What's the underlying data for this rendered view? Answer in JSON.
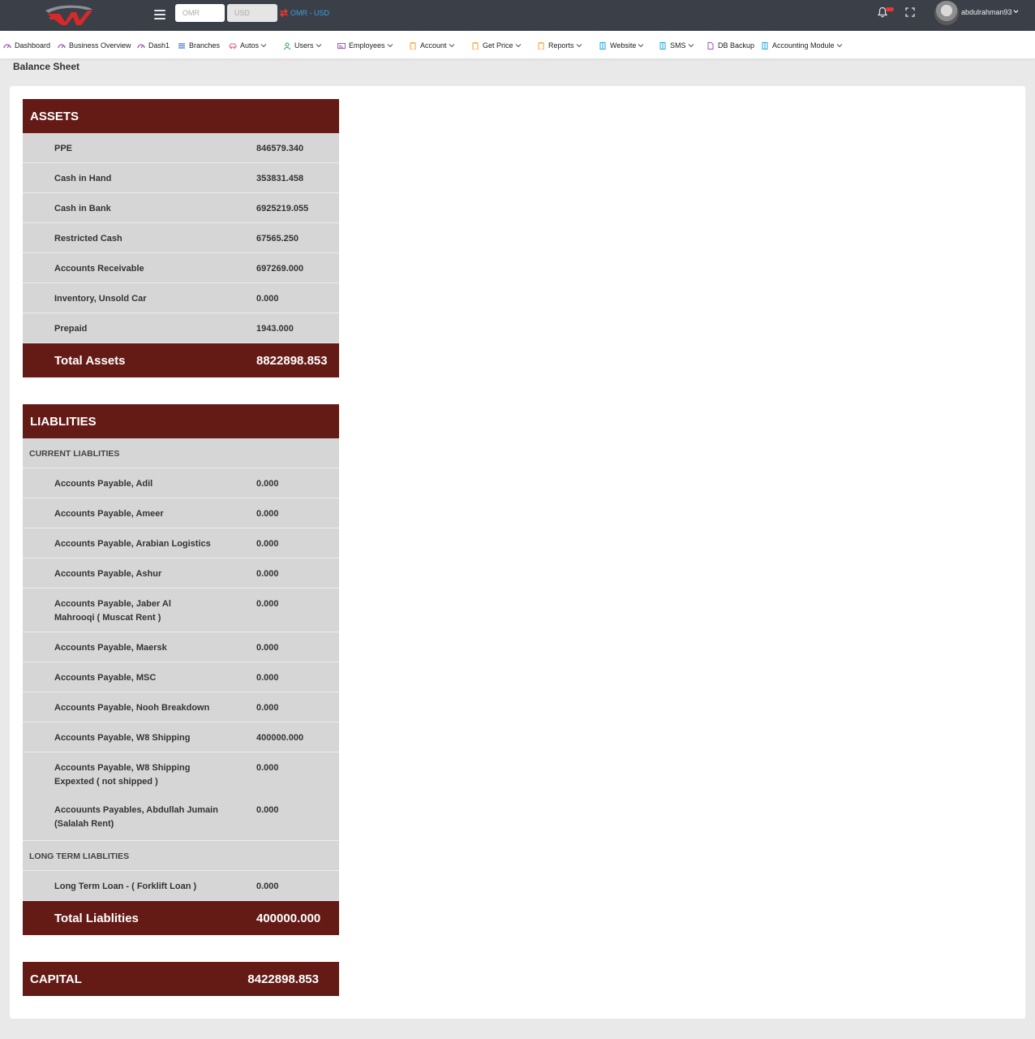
{
  "header": {
    "currency_from_placeholder": "OMR",
    "currency_to_placeholder": "USD",
    "currency_pair_label": "OMR - USD",
    "username": "abdulrahman93"
  },
  "menu": [
    {
      "label": "Dashboard",
      "icon": "dashboard-icon",
      "color": "#9b59b6"
    },
    {
      "label": "Business Overview",
      "icon": "dashboard-icon",
      "color": "#9b59b6"
    },
    {
      "label": "Dash1",
      "icon": "dashboard-icon",
      "color": "#9b59b6"
    },
    {
      "label": "Branches",
      "icon": "branches-icon",
      "color": "#3f6fd8"
    },
    {
      "label": "Autos",
      "icon": "car-icon",
      "color": "#e05a8c"
    },
    {
      "label": "Users",
      "icon": "user-icon",
      "color": "#2eaa4a"
    },
    {
      "label": "Employees",
      "icon": "id-card-icon",
      "color": "#9b59b6"
    },
    {
      "label": "Account",
      "icon": "clipboard-icon",
      "color": "#f0a020"
    },
    {
      "label": "Get Price",
      "icon": "clipboard-icon",
      "color": "#f0a020"
    },
    {
      "label": "Reports",
      "icon": "clipboard-icon",
      "color": "#f0a020"
    },
    {
      "label": "Website",
      "icon": "building-icon",
      "color": "#26a6e0"
    },
    {
      "label": "SMS",
      "icon": "building-icon",
      "color": "#26a6e0"
    },
    {
      "label": "DB Backup",
      "icon": "file-icon",
      "color": "#9b59b6"
    },
    {
      "label": "Accounting Module",
      "icon": "building-icon",
      "color": "#26a6e0"
    }
  ],
  "page_title": "Balance Sheet",
  "assets": {
    "heading": "ASSETS",
    "rows": [
      {
        "label": "PPE",
        "value": "846579.340"
      },
      {
        "label": "Cash in Hand",
        "value": "353831.458"
      },
      {
        "label": "Cash in Bank",
        "value": "6925219.055"
      },
      {
        "label": "Restricted Cash",
        "value": "67565.250"
      },
      {
        "label": "Accounts Receivable",
        "value": "697269.000"
      },
      {
        "label": "Inventory, Unsold Car",
        "value": "0.000"
      },
      {
        "label": "Prepaid",
        "value": "1943.000"
      }
    ],
    "total_label": "Total Assets",
    "total_value": "8822898.853"
  },
  "liabilities": {
    "heading": "LIABLITIES",
    "current_heading": "CURRENT LIABLITIES",
    "current_rows": [
      {
        "label": "Accounts Payable, Adil",
        "value": "0.000"
      },
      {
        "label": "Accounts Payable, Ameer",
        "value": "0.000"
      },
      {
        "label": "Accounts Payable, Arabian Logistics",
        "value": "0.000"
      },
      {
        "label": "Accounts Payable, Ashur",
        "value": "0.000"
      },
      {
        "label": "Accounts Payable, Jaber Al Mahrooqi ( Muscat Rent )",
        "value": "0.000"
      },
      {
        "label": "Accounts Payable, Maersk",
        "value": "0.000"
      },
      {
        "label": "Accounts Payable, MSC",
        "value": "0.000"
      },
      {
        "label": "Accounts Payable, Nooh Breakdown",
        "value": "0.000"
      },
      {
        "label": "Accounts Payable, W8 Shipping",
        "value": "400000.000"
      },
      {
        "label": "Accounts Payable, W8 Shipping Expexted ( not shipped )",
        "value": "0.000"
      },
      {
        "label": "Accouunts Payables, Abdullah Jumain (Salalah Rent)",
        "value": "0.000"
      }
    ],
    "long_term_heading": "LONG TERM LIABLITIES",
    "long_term_rows": [
      {
        "label": "Long Term Loan - ( Forklift Loan )",
        "value": "0.000"
      }
    ],
    "total_label": "Total Liablities",
    "total_value": "400000.000"
  },
  "capital": {
    "label": "CAPITAL",
    "value": "8422898.853"
  },
  "colors": {
    "topbar": "#3a3f48",
    "section_header": "#641b16",
    "row_background": "#d6d6d6",
    "accent_blue": "#3fa0d8"
  }
}
